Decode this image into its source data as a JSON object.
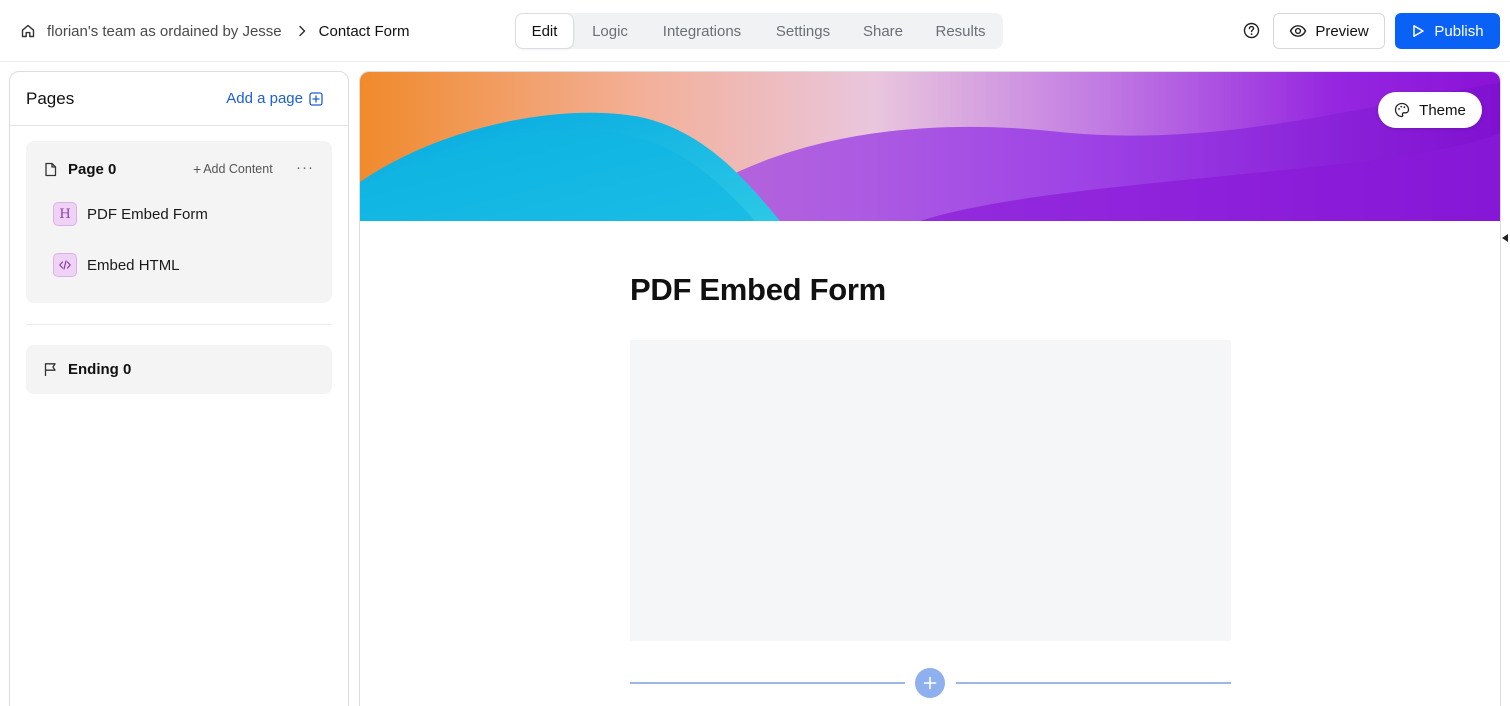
{
  "header": {
    "breadcrumb": {
      "team": "florian's team as ordained by Jesse",
      "current": "Contact Form"
    },
    "tabs": [
      {
        "label": "Edit",
        "active": true
      },
      {
        "label": "Logic",
        "active": false
      },
      {
        "label": "Integrations",
        "active": false
      },
      {
        "label": "Settings",
        "active": false
      },
      {
        "label": "Share",
        "active": false
      },
      {
        "label": "Results",
        "active": false
      }
    ],
    "preview_label": "Preview",
    "publish_label": "Publish"
  },
  "sidebar": {
    "title": "Pages",
    "add_page_label": "Add a page",
    "page": {
      "title": "Page 0",
      "add_content_label": "Add Content",
      "more_label": "···",
      "items": [
        {
          "badge": "H",
          "label": "PDF Embed Form",
          "icon": "heading-icon"
        },
        {
          "badge": "</>",
          "label": "Embed HTML",
          "icon": "code-icon"
        }
      ]
    },
    "ending": {
      "title": "Ending 0"
    }
  },
  "canvas": {
    "theme_label": "Theme",
    "form_title": "PDF Embed Form"
  },
  "colors": {
    "accent": "#0a61f5",
    "link": "#1d5fd6",
    "badge_bg": "#efd3f7",
    "add_line": "#9db7e6"
  }
}
